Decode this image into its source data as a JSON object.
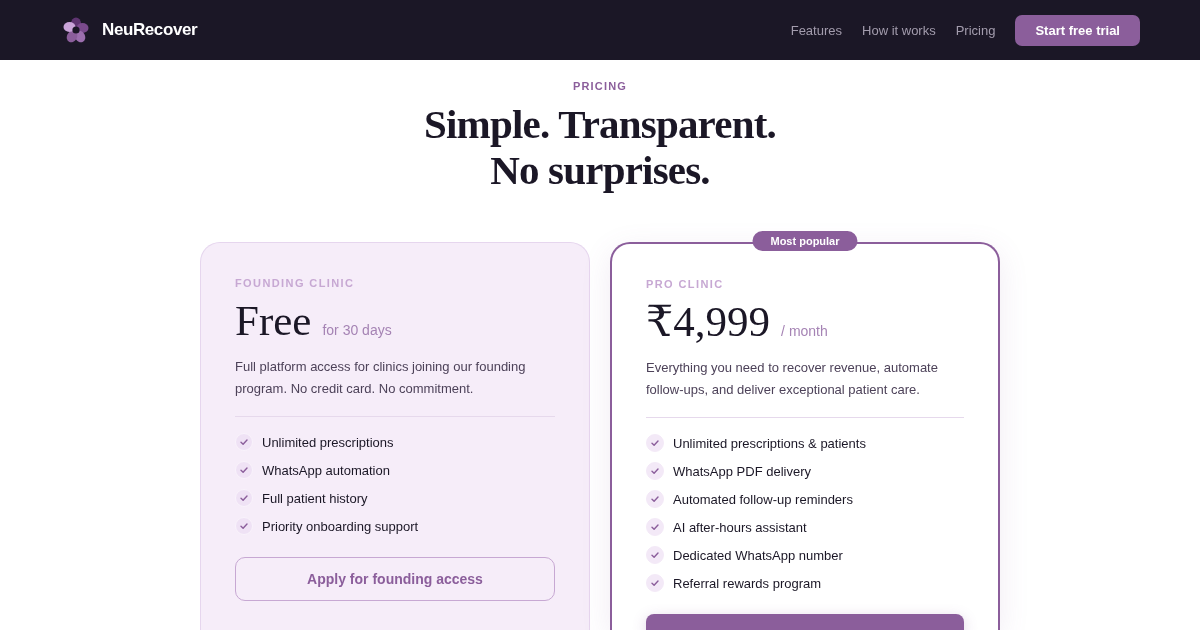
{
  "nav": {
    "brand": "NeuRecover",
    "links": [
      "Features",
      "How it works",
      "Pricing"
    ],
    "cta": "Start free trial"
  },
  "hero": {
    "eyebrow": "PRICING",
    "title_lines": [
      "Simple. Transparent.",
      "No surprises."
    ]
  },
  "plans": [
    {
      "kind": "standard",
      "label": "FOUNDING CLINIC",
      "price": "Free",
      "period": "for 30 days",
      "description": "Full platform access for clinics joining our founding program. No credit card. No commitment.",
      "features": [
        "Unlimited prescriptions",
        "WhatsApp automation",
        "Full patient history",
        "Priority onboarding support"
      ],
      "button": {
        "kind": "outline",
        "label": "Apply for founding access"
      }
    },
    {
      "kind": "featured",
      "badge": "Most popular",
      "label": "PRO CLINIC",
      "price": "₹4,999",
      "period": "/ month",
      "description": "Everything you need to recover revenue, automate follow-ups, and deliver exceptional patient care.",
      "features": [
        "Unlimited prescriptions & patients",
        "WhatsApp PDF delivery",
        "Automated follow-up reminders",
        "AI after-hours assistant",
        "Dedicated WhatsApp number",
        "Referral rewards program"
      ],
      "button": {
        "kind": "filled"
      }
    }
  ]
}
